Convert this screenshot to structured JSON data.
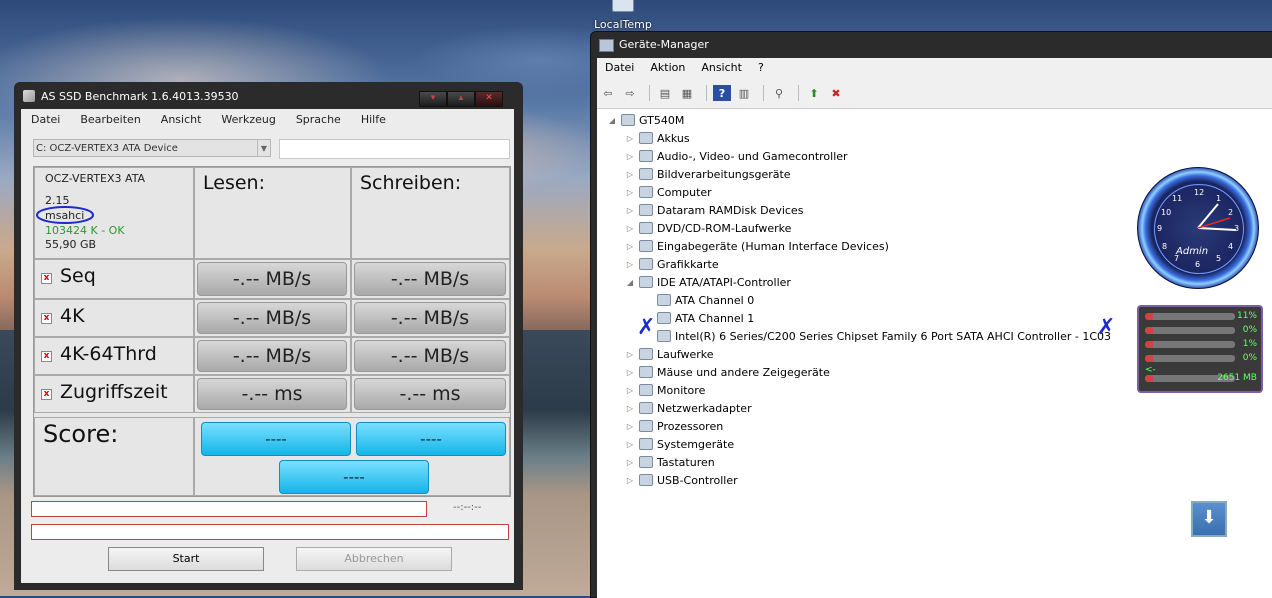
{
  "desktop": {
    "icon_label": "LocalTemp"
  },
  "asssd": {
    "title": "AS SSD Benchmark 1.6.4013.39530",
    "menu": [
      "Datei",
      "Bearbeiten",
      "Ansicht",
      "Werkzeug",
      "Sprache",
      "Hilfe"
    ],
    "drive_select": "C: OCZ-VERTEX3 ATA Device",
    "info": {
      "model": "OCZ-VERTEX3 ATA",
      "firmware": "2.15",
      "driver": "msahci",
      "align": "103424 K - OK",
      "size": "55,90 GB"
    },
    "headers": {
      "read": "Lesen:",
      "write": "Schreiben:"
    },
    "rows": [
      {
        "label": "Seq",
        "read": "-.-- MB/s",
        "write": "-.-- MB/s"
      },
      {
        "label": "4K",
        "read": "-.-- MB/s",
        "write": "-.-- MB/s"
      },
      {
        "label": "4K-64Thrd",
        "read": "-.-- MB/s",
        "write": "-.-- MB/s"
      },
      {
        "label": "Zugriffszeit",
        "read": "-.-- ms",
        "write": "-.-- ms"
      }
    ],
    "score_label": "Score:",
    "score_read": "----",
    "score_write": "----",
    "score_total": "----",
    "time": "--:--:--",
    "start": "Start",
    "cancel": "Abbrechen",
    "colors": {
      "align_ok": "#2a9a2a",
      "score_button": "#14b5e8"
    }
  },
  "devmgr": {
    "title": "Geräte-Manager",
    "menu": [
      "Datei",
      "Aktion",
      "Ansicht",
      "?"
    ],
    "root": "GT540M",
    "nodes": [
      "Akkus",
      "Audio-, Video- und Gamecontroller",
      "Bildverarbeitungsgeräte",
      "Computer",
      "Dataram RAMDisk Devices",
      "DVD/CD-ROM-Laufwerke",
      "Eingabegeräte (Human Interface Devices)",
      "Grafikkarte",
      "IDE ATA/ATAPI-Controller",
      "ATA Channel 0",
      "ATA Channel 1",
      "Intel(R) 6 Series/C200 Series Chipset Family 6 Port SATA AHCI Controller - 1C03",
      "Laufwerke",
      "Mäuse und andere Zeigegeräte",
      "Monitore",
      "Netzwerkadapter",
      "Prozessoren",
      "Systemgeräte",
      "Tastaturen",
      "USB-Controller"
    ]
  },
  "gadgets": {
    "clock_brand": "Admin",
    "clock_numbers": [
      "12",
      "1",
      "2",
      "3",
      "4",
      "5",
      "6",
      "7",
      "8",
      "9",
      "10",
      "11"
    ],
    "meter_values": [
      "11%",
      "0%",
      "1%",
      "0%"
    ],
    "meter_arrow": "<-",
    "meter_mem": "2651 MB"
  }
}
